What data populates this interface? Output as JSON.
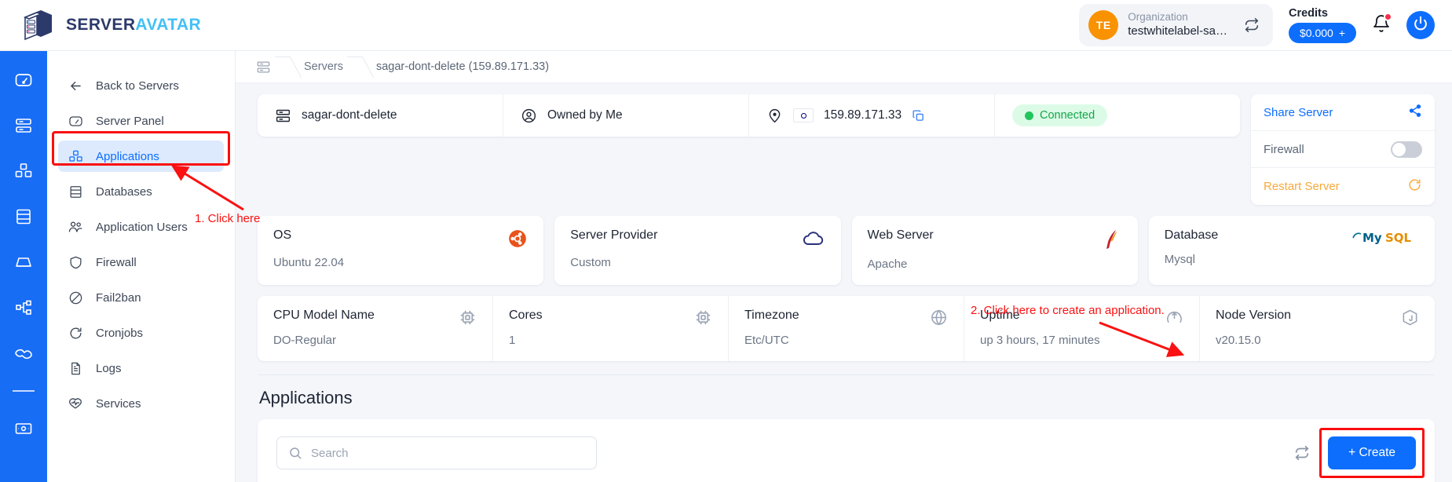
{
  "brand": {
    "part1": "SERVER",
    "part2": "AVATAR",
    "logo_icon": "server-cube-logo"
  },
  "topbar": {
    "org": {
      "avatar_initials": "TE",
      "label": "Organization",
      "value": "testwhitelabel-sa…",
      "swap_icon": "swap-arrows-icon"
    },
    "credits": {
      "label": "Credits",
      "amount": "$0.000",
      "plus": "+"
    },
    "notifications_icon": "bell-icon",
    "power_icon": "power-icon"
  },
  "rail": {
    "items": [
      {
        "name": "dashboard",
        "icon": "gauge-icon"
      },
      {
        "name": "servers",
        "icon": "server-stack-icon"
      },
      {
        "name": "applications",
        "icon": "boxes-icon"
      },
      {
        "name": "databases",
        "icon": "database-icon"
      },
      {
        "name": "backups",
        "icon": "drive-icon"
      },
      {
        "name": "git",
        "icon": "branch-icon"
      },
      {
        "name": "partners",
        "icon": "handshake-icon"
      },
      {
        "name": "billing",
        "icon": "card-icon"
      }
    ]
  },
  "sidebar": {
    "items": [
      {
        "label": "Back to Servers",
        "icon": "arrow-left-icon",
        "active": false
      },
      {
        "label": "Server Panel",
        "icon": "gauge-icon",
        "active": false
      },
      {
        "label": "Applications",
        "icon": "boxes-icon",
        "active": true
      },
      {
        "label": "Databases",
        "icon": "database-icon",
        "active": false
      },
      {
        "label": "Application Users",
        "icon": "users-icon",
        "active": false
      },
      {
        "label": "Firewall",
        "icon": "shield-icon",
        "active": false
      },
      {
        "label": "Fail2ban",
        "icon": "ban-icon",
        "active": false
      },
      {
        "label": "Cronjobs",
        "icon": "refresh-icon",
        "active": false
      },
      {
        "label": "Logs",
        "icon": "document-icon",
        "active": false
      },
      {
        "label": "Services",
        "icon": "heartbeat-icon",
        "active": false
      }
    ]
  },
  "breadcrumb": {
    "home_icon": "server-stack-icon",
    "items": [
      "Servers",
      "sagar-dont-delete (159.89.171.33)"
    ]
  },
  "summary": {
    "server_name": "sagar-dont-delete",
    "server_name_icon": "server-stack-icon",
    "ownership": "Owned by Me",
    "ownership_icon": "user-circle-icon",
    "location_icon": "map-pin-icon",
    "flag": "india-flag",
    "ip": "159.89.171.33",
    "copy_icon": "copy-icon",
    "status": "Connected"
  },
  "actions": {
    "share": {
      "label": "Share Server",
      "icon": "share-icon"
    },
    "firewall": {
      "label": "Firewall",
      "icon": "toggle-switch",
      "enabled": false
    },
    "restart": {
      "label": "Restart Server",
      "icon": "refresh-icon"
    }
  },
  "tiles_row1": [
    {
      "title": "OS",
      "value": "Ubuntu 22.04",
      "icon": "ubuntu-icon"
    },
    {
      "title": "Server Provider",
      "value": "Custom",
      "icon": "cloud-icon"
    },
    {
      "title": "Web Server",
      "value": "Apache",
      "icon": "apache-feather-icon"
    },
    {
      "title": "Database",
      "value": "Mysql",
      "icon": "mysql-icon"
    }
  ],
  "tiles_row2": [
    {
      "title": "CPU Model Name",
      "value": "DO-Regular",
      "icon": "chip-icon"
    },
    {
      "title": "Cores",
      "value": "1",
      "icon": "chip-icon"
    },
    {
      "title": "Timezone",
      "value": "Etc/UTC",
      "icon": "globe-icon"
    },
    {
      "title": "Uptime",
      "value": "up 3 hours, 17 minutes",
      "icon": "uptime-icon"
    },
    {
      "title": "Node Version",
      "value": "v20.15.0",
      "icon": "nodejs-icon"
    }
  ],
  "applications": {
    "heading": "Applications",
    "search_placeholder": "Search",
    "search_value": "",
    "search_icon": "search-icon",
    "refresh_icon": "refresh-icon",
    "create_label": "+ Create"
  },
  "annotations": [
    {
      "id": "anno1",
      "text": "1. Click here"
    },
    {
      "id": "anno2",
      "text": "2. Click here to create an application."
    }
  ],
  "colors": {
    "accent_blue": "#0d6efd",
    "rail_blue": "#186df5",
    "annotation_red": "#fb1111",
    "status_green": "#17a34a",
    "restart_orange": "#f7a93b",
    "org_avatar_orange": "#f99200"
  }
}
